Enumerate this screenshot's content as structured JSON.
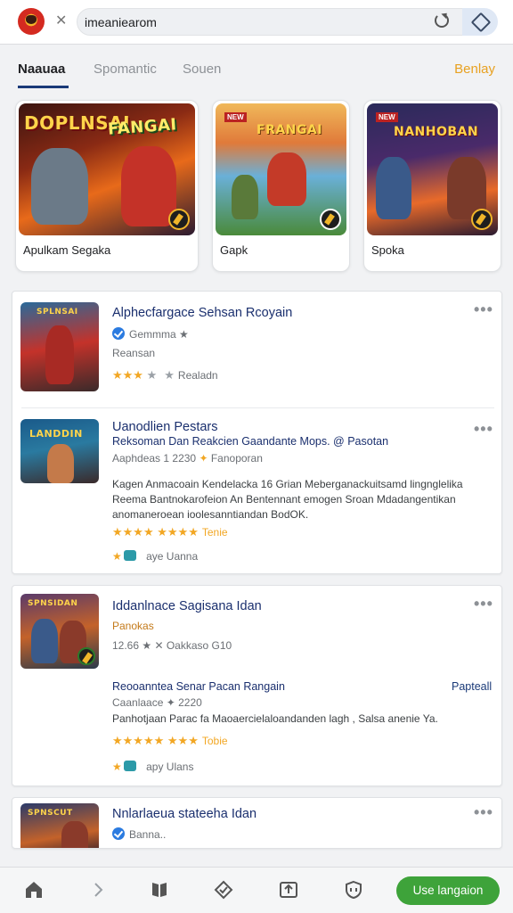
{
  "colors": {
    "accent": "#1a3a78",
    "star": "#f2a724",
    "cta": "#3ea33a",
    "link_orange": "#e8a120"
  },
  "address_bar": {
    "url": "imeaniearom",
    "logo_icon": "app-logo-icon",
    "reload_icon": "reload-icon",
    "extension_icon": "extension-icon"
  },
  "tabs": [
    {
      "label": "Naauaa",
      "active": true
    },
    {
      "label": "Spomantic",
      "active": false
    },
    {
      "label": "Souen",
      "active": false
    }
  ],
  "tab_link": "Benlay",
  "featured": [
    {
      "banner": "DOPLNSAI",
      "banner2": "FANGAI",
      "label": "Apulkam Segaka"
    },
    {
      "banner": "FRANGAI",
      "tag": "NEW",
      "label": "Gapk"
    },
    {
      "banner": "NANHOBAN",
      "tag": "NEW",
      "label": "Spoka"
    }
  ],
  "items": [
    {
      "thumb_banner": "SPLNSAI",
      "title": "Alphecfargace Sehsan Rcoyain",
      "meta": "Gemmma ★",
      "meta2": "Reansan",
      "stars": "★★★",
      "rating_label": "Realadn"
    },
    {
      "thumb_banner": "LANDDIN",
      "title": "Uanodlien Pestars",
      "subtitle": "Reksoman Dan Reakcien Gaandante Mops. @ Pasotan",
      "meta": "Aaphdeas 1 2230",
      "meta_link": "Fanoporan",
      "desc": "Kagen Anmacoain Kendelacka 16 Grian Meberganackuitsamd lingnglelika Reema Bantnokarofeion An Bentennant emogen Sroan Mdadangentikan anomaneroean ioolesanntiandan BodOK.",
      "stars_line": "★★★★ ★★★★",
      "stars_label": "Tenie",
      "footer": "aye Uanna"
    },
    {
      "thumb_banner": "SPNSIDAN",
      "title": "Iddanlnace Sagisana Idan",
      "subtitle": "Panokas",
      "meta": "12.66 ★ ✕ Oakkaso G10",
      "sub_title2": "Reooanntea Senar Pacan Rangain",
      "side_link": "Papteall",
      "meta2": "Caanlaace ✦ 2220",
      "desc": "Panhotjaan Parac fa Maoaercielaloandanden lagh , Salsa anenie Ya.",
      "stars_line": "★★★★★ ★★★",
      "stars_label": "Tobie",
      "footer": "apy Ulans"
    },
    {
      "thumb_banner": "SPNSCUT",
      "title": "Nnlarlaeua stateeha Idan",
      "meta": "Banna.."
    }
  ],
  "bottom_bar": {
    "icons": [
      "home-icon",
      "chevron-right-icon",
      "book-icon",
      "diamond-icon",
      "share-icon",
      "shield-icon"
    ],
    "cta_label": "Use langaion"
  }
}
